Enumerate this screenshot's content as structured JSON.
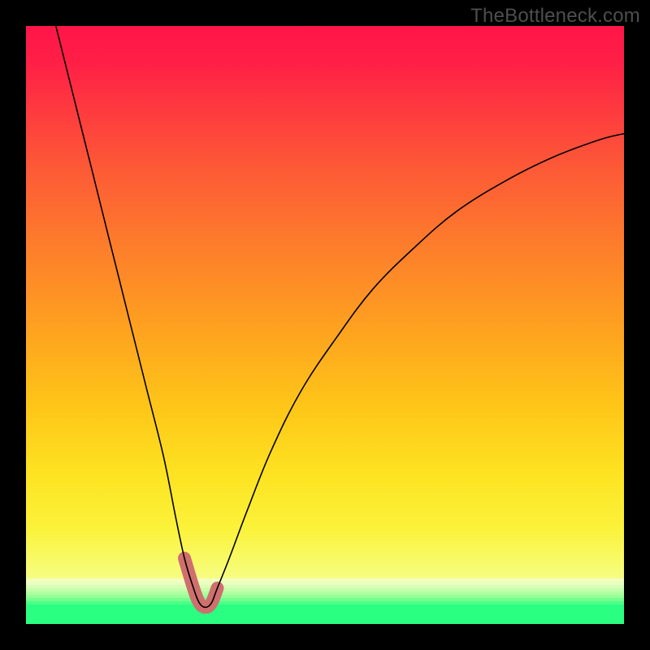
{
  "watermark": "TheBottleneck.com",
  "colors": {
    "page_bg": "#000000",
    "watermark": "#4e4e4e",
    "curve_thin": "#000000",
    "curve_thick": "#cf6f6e",
    "gradient_top": "#ff1549",
    "gradient_mid": "#fec418",
    "gradient_low": "#f8fb6d",
    "band_green": "#2bff82"
  },
  "bottom_bands": [
    "#f2ffc0",
    "#eaffbf",
    "#d8ffb6",
    "#c6ffab",
    "#b0ffa1",
    "#96ff98",
    "#74ff8f",
    "#4cff87",
    "#2bff82",
    "#2bff82",
    "#2bff82",
    "#2bff82",
    "#2bff82",
    "#2bff82"
  ],
  "chart_data": {
    "type": "line",
    "title": "",
    "xlabel": "",
    "ylabel": "",
    "xlim": [
      0,
      100
    ],
    "ylim": [
      0,
      100
    ],
    "series": [
      {
        "name": "bottleneck-curve",
        "x": [
          5,
          8,
          11,
          14,
          17,
          20,
          23,
          25,
          26.5,
          28,
          29,
          30,
          31,
          32,
          34,
          37,
          41,
          46,
          52,
          58,
          65,
          72,
          80,
          88,
          96,
          100
        ],
        "y": [
          100,
          88,
          76,
          64,
          52,
          40,
          28,
          18,
          11,
          6,
          3.5,
          2.8,
          3.5,
          6,
          11,
          19,
          29,
          39,
          48,
          56,
          63,
          69,
          74,
          78,
          81,
          82
        ]
      }
    ],
    "highlight": {
      "name": "trough-segment",
      "x_range": [
        25.5,
        33.5
      ],
      "note": "thick desaturated-red overlay around the minimum"
    },
    "annotations": [
      {
        "text": "TheBottleneck.com",
        "pos": "top-right"
      }
    ]
  }
}
